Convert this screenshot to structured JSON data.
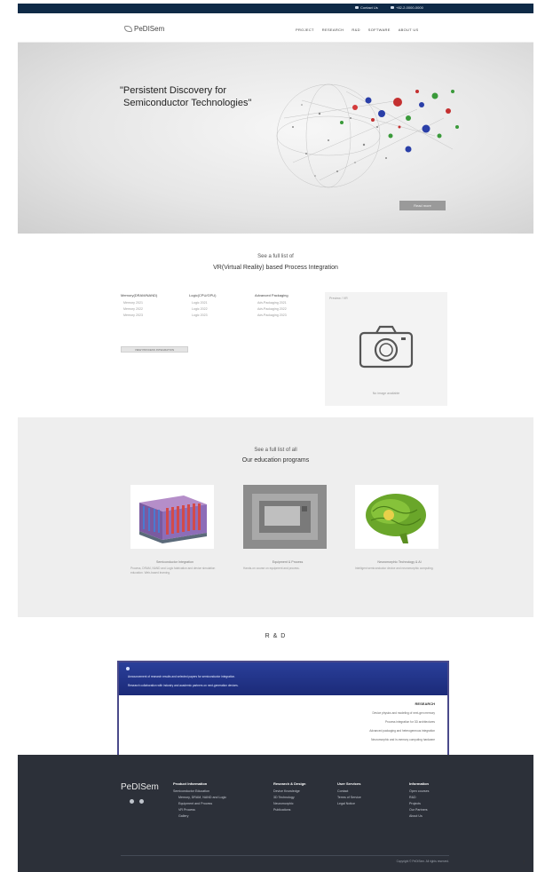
{
  "topbar": {
    "email": "Contact Us",
    "phone": "+82-2-0000-0000"
  },
  "header": {
    "logo_text": "PeDISem",
    "nav": [
      "PROJECT",
      "RESEARCH",
      "R&D",
      "SOFTWARE",
      "ABOUT US"
    ]
  },
  "hero": {
    "title_line1": "\"Persistent Discovery for",
    "title_line2": "Semiconductor Technologies\"",
    "button": "Read more"
  },
  "vr": {
    "subtitle": "See a full list of",
    "title": "VR(Virtual Reality) based Process Integration",
    "columns": [
      {
        "heading": "Memory(DRAM/NAND)",
        "items": [
          "Memory 2021",
          "Memory 2022",
          "Memory 2023"
        ]
      },
      {
        "heading": "Logic(CPU/GPU)",
        "items": [
          "Logic 2021",
          "Logic 2022",
          "Logic 2023"
        ]
      },
      {
        "heading": "Advanced Packaging",
        "items": [
          "Adv.Packaging 2021",
          "Adv.Packaging 2022",
          "Adv.Packaging 2023"
        ]
      }
    ],
    "button": "VIEW PROCESS INTEGRATION",
    "preview_top": "Preview / VR",
    "preview_bottom": "No image available"
  },
  "education": {
    "subtitle": "See a full list of all",
    "title": "Our education programs",
    "cards": [
      {
        "caption": "Semiconductor Integration",
        "desc": "Process, DRAM, NAND and Logic fabrication and device simulation education. Web-based learning."
      },
      {
        "caption": "Equipment & Process",
        "desc": "Hands-on course on equipment and process."
      },
      {
        "caption": "Neuromorphic Technology & AI",
        "desc": "Intelligent semiconductor device and neuromorphic computing."
      }
    ]
  },
  "rd": {
    "title": "R & D",
    "banner_lines": [
      "Announcement of research results and selected papers for semiconductor integration.",
      "Research collaboration with industry and academic partners on next-generation devices."
    ],
    "list_heading": "RESEARCH",
    "list_items": [
      "Device physics and modeling of next-gen memory",
      "Process integration for 3D architectures",
      "Advanced packaging and heterogeneous integration",
      "Neuromorphic and in-memory computing hardware"
    ]
  },
  "footer": {
    "logo": "PeDISem",
    "columns": [
      {
        "heading": "Product Information",
        "items": [
          "Semiconductor Education",
          "Memory, DRAM, NAND and Logic",
          "Equipment and Process",
          "VR Process",
          "Gallery"
        ]
      },
      {
        "heading": "Research & Design",
        "items": [
          "Device Knowledge",
          "3D Technology",
          "Neuromorphic",
          "Publications"
        ]
      },
      {
        "heading": "User Services",
        "items": [
          "Contact",
          "Terms of Service",
          "Legal Notice"
        ]
      },
      {
        "heading": "Information",
        "items": [
          "Open courses",
          "R&D",
          "Projects",
          "Our Partners",
          "About Us"
        ]
      }
    ],
    "copyright": "Copyright © PeDISem. All rights reserved."
  }
}
